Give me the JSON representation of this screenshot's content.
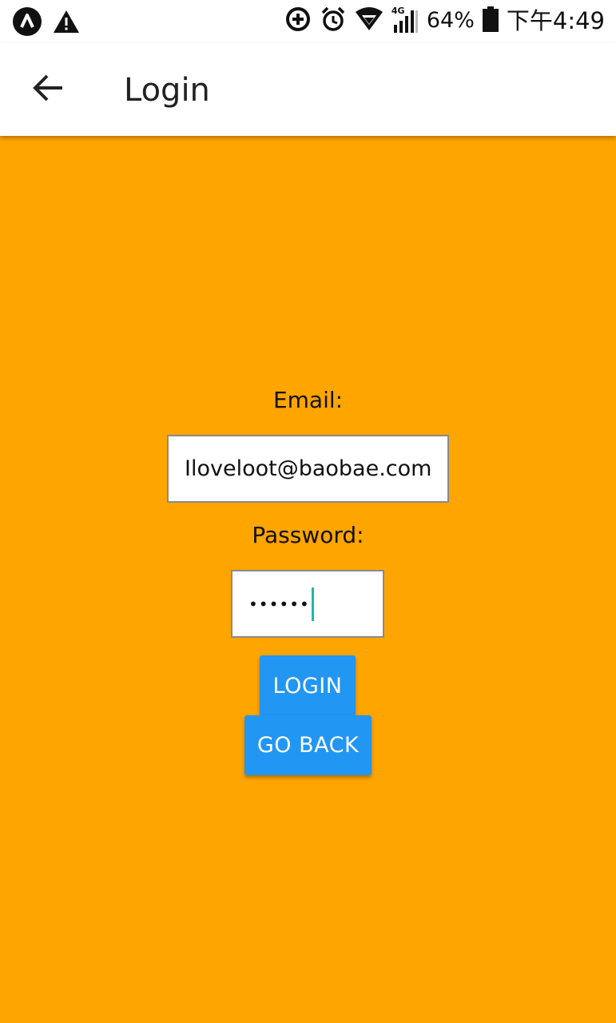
{
  "status_bar": {
    "left_icons": [
      "app-a-icon",
      "warning-icon"
    ],
    "right_icons": [
      "data-saver-icon",
      "alarm-icon",
      "wifi-icon",
      "signal-4g-icon",
      "battery-icon"
    ],
    "network_label": "4G",
    "battery_percent": "64%",
    "time": "下午4:49"
  },
  "app_bar": {
    "back_icon": "arrow-left-icon",
    "title": "Login"
  },
  "form": {
    "email_label": "Email:",
    "email_value": "Iloveloot@baobae.com",
    "password_label": "Password:",
    "password_value": "••••••",
    "login_label": "LOGIN",
    "go_back_label": "GO BACK"
  },
  "colors": {
    "background": "#ffa500",
    "button": "#2196f3",
    "caret": "#26b5b0"
  }
}
